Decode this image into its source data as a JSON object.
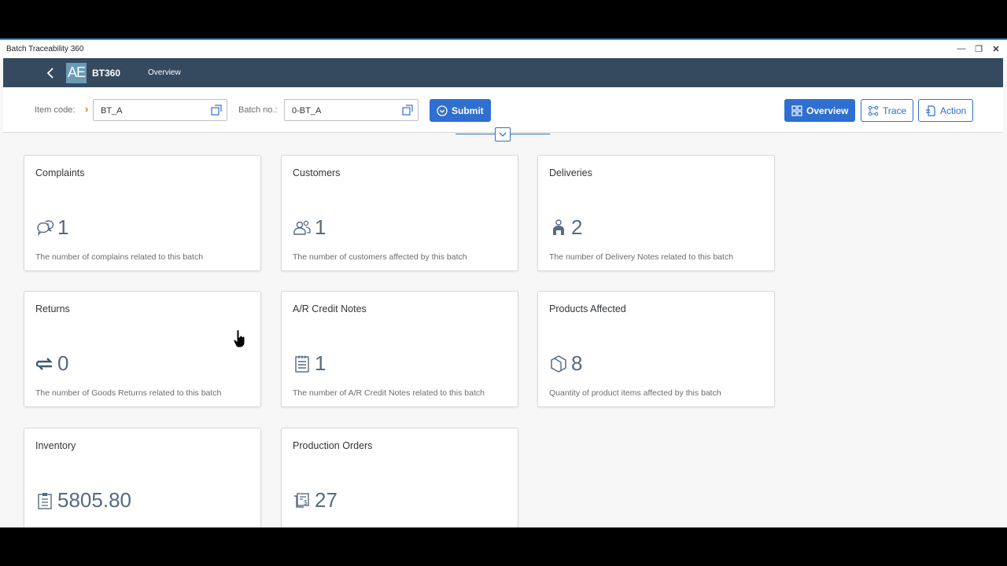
{
  "window": {
    "title": "Batch Traceability 360"
  },
  "shellbar": {
    "logo_text": "AE",
    "app_name": "BT360",
    "nav_link": "Overview"
  },
  "filters": {
    "item_code": {
      "label": "Item code:",
      "value": "BT_A"
    },
    "batch_no": {
      "label": "Batch no.:",
      "value": "0-BT_A"
    },
    "submit_label": "Submit"
  },
  "actions": {
    "overview": "Overview",
    "trace": "Trace",
    "action": "Action"
  },
  "cards": [
    {
      "title": "Complaints",
      "value": "1",
      "desc": "The number of complains related to this batch"
    },
    {
      "title": "Customers",
      "value": "1",
      "desc": "The number of customers affected by this batch"
    },
    {
      "title": "Deliveries",
      "value": "2",
      "desc": "The number of Delivery Notes related to this batch"
    },
    {
      "title": "Returns",
      "value": "0",
      "desc": "The number of Goods Returns related to this batch"
    },
    {
      "title": "A/R Credit Notes",
      "value": "1",
      "desc": "The number of A/R Credit Notes related to this batch"
    },
    {
      "title": "Products Affected",
      "value": "8",
      "desc": "Quantity of product items affected by this batch"
    },
    {
      "title": "Inventory",
      "value": "5805.80",
      "desc": ""
    },
    {
      "title": "Production Orders",
      "value": "27",
      "desc": ""
    }
  ],
  "icons": {
    "complaints": "complaint-chat-icon",
    "customers": "customers-icon",
    "deliveries": "delivery-person-icon",
    "returns": "return-arrows-icon",
    "credit_notes": "document-list-icon",
    "products": "product-box-icon",
    "inventory": "clipboard-icon",
    "production": "production-order-icon"
  },
  "colors": {
    "shellbar": "#354a5f",
    "accent": "#2f6fd1",
    "kpi": "#556b82"
  }
}
